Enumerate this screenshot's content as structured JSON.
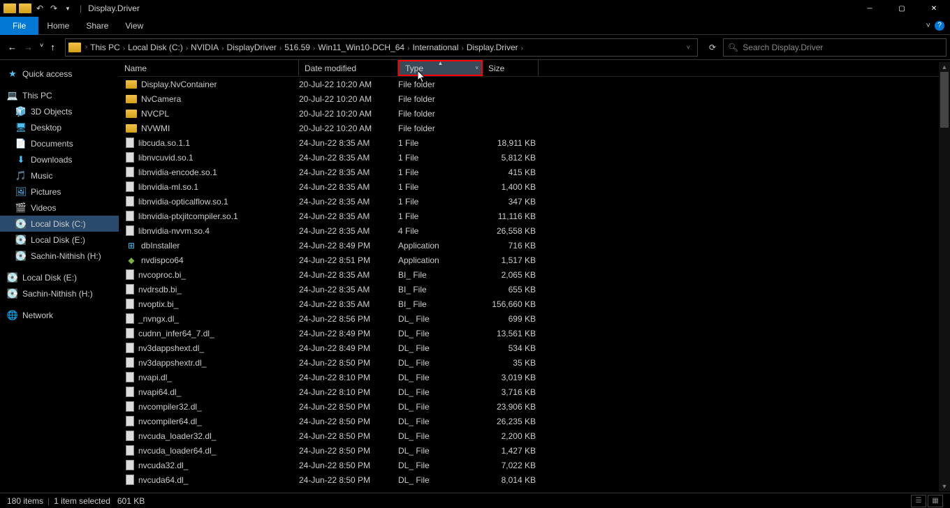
{
  "window": {
    "title": "Display.Driver"
  },
  "ribbon": {
    "file": "File",
    "home": "Home",
    "share": "Share",
    "view": "View"
  },
  "breadcrumb": [
    "This PC",
    "Local Disk (C:)",
    "NVIDIA",
    "DisplayDriver",
    "516.59",
    "Win11_Win10-DCH_64",
    "International",
    "Display.Driver"
  ],
  "search": {
    "placeholder": "Search Display.Driver"
  },
  "nav": {
    "quick": "Quick access",
    "thispc": "This PC",
    "thispc_items": [
      "3D Objects",
      "Desktop",
      "Documents",
      "Downloads",
      "Music",
      "Pictures",
      "Videos",
      "Local Disk (C:)",
      "Local Disk (E:)",
      "Sachin-Nithish (H:)"
    ],
    "drives": [
      "Local Disk (E:)",
      "Sachin-Nithish (H:)"
    ],
    "network": "Network"
  },
  "columns": {
    "name": "Name",
    "date": "Date modified",
    "type": "Type",
    "size": "Size"
  },
  "files": [
    {
      "name": "Display.NvContainer",
      "date": "20-Jul-22 10:20 AM",
      "type": "File folder",
      "size": "",
      "icon": "folder"
    },
    {
      "name": "NvCamera",
      "date": "20-Jul-22 10:20 AM",
      "type": "File folder",
      "size": "",
      "icon": "folder"
    },
    {
      "name": "NVCPL",
      "date": "20-Jul-22 10:20 AM",
      "type": "File folder",
      "size": "",
      "icon": "folder"
    },
    {
      "name": "NVWMI",
      "date": "20-Jul-22 10:20 AM",
      "type": "File folder",
      "size": "",
      "icon": "folder"
    },
    {
      "name": "libcuda.so.1.1",
      "date": "24-Jun-22 8:35 AM",
      "type": "1 File",
      "size": "18,911 KB",
      "icon": "doc"
    },
    {
      "name": "libnvcuvid.so.1",
      "date": "24-Jun-22 8:35 AM",
      "type": "1 File",
      "size": "5,812 KB",
      "icon": "doc"
    },
    {
      "name": "libnvidia-encode.so.1",
      "date": "24-Jun-22 8:35 AM",
      "type": "1 File",
      "size": "415 KB",
      "icon": "doc"
    },
    {
      "name": "libnvidia-ml.so.1",
      "date": "24-Jun-22 8:35 AM",
      "type": "1 File",
      "size": "1,400 KB",
      "icon": "doc"
    },
    {
      "name": "libnvidia-opticalflow.so.1",
      "date": "24-Jun-22 8:35 AM",
      "type": "1 File",
      "size": "347 KB",
      "icon": "doc"
    },
    {
      "name": "libnvidia-ptxjitcompiler.so.1",
      "date": "24-Jun-22 8:35 AM",
      "type": "1 File",
      "size": "11,116 KB",
      "icon": "doc"
    },
    {
      "name": "libnvidia-nvvm.so.4",
      "date": "24-Jun-22 8:35 AM",
      "type": "4 File",
      "size": "26,558 KB",
      "icon": "doc"
    },
    {
      "name": "dbInstaller",
      "date": "24-Jun-22 8:49 PM",
      "type": "Application",
      "size": "716 KB",
      "icon": "app"
    },
    {
      "name": "nvdispco64",
      "date": "24-Jun-22 8:51 PM",
      "type": "Application",
      "size": "1,517 KB",
      "icon": "app2"
    },
    {
      "name": "nvcoproc.bi_",
      "date": "24-Jun-22 8:35 AM",
      "type": "BI_ File",
      "size": "2,065 KB",
      "icon": "doc"
    },
    {
      "name": "nvdrsdb.bi_",
      "date": "24-Jun-22 8:35 AM",
      "type": "BI_ File",
      "size": "655 KB",
      "icon": "doc"
    },
    {
      "name": "nvoptix.bi_",
      "date": "24-Jun-22 8:35 AM",
      "type": "BI_ File",
      "size": "156,660 KB",
      "icon": "doc"
    },
    {
      "name": "_nvngx.dl_",
      "date": "24-Jun-22 8:56 PM",
      "type": "DL_ File",
      "size": "699 KB",
      "icon": "doc"
    },
    {
      "name": "cudnn_infer64_7.dl_",
      "date": "24-Jun-22 8:49 PM",
      "type": "DL_ File",
      "size": "13,561 KB",
      "icon": "doc"
    },
    {
      "name": "nv3dappshext.dl_",
      "date": "24-Jun-22 8:49 PM",
      "type": "DL_ File",
      "size": "534 KB",
      "icon": "doc"
    },
    {
      "name": "nv3dappshextr.dl_",
      "date": "24-Jun-22 8:50 PM",
      "type": "DL_ File",
      "size": "35 KB",
      "icon": "doc"
    },
    {
      "name": "nvapi.dl_",
      "date": "24-Jun-22 8:10 PM",
      "type": "DL_ File",
      "size": "3,019 KB",
      "icon": "doc"
    },
    {
      "name": "nvapi64.dl_",
      "date": "24-Jun-22 8:10 PM",
      "type": "DL_ File",
      "size": "3,716 KB",
      "icon": "doc"
    },
    {
      "name": "nvcompiler32.dl_",
      "date": "24-Jun-22 8:50 PM",
      "type": "DL_ File",
      "size": "23,906 KB",
      "icon": "doc"
    },
    {
      "name": "nvcompiler64.dl_",
      "date": "24-Jun-22 8:50 PM",
      "type": "DL_ File",
      "size": "26,235 KB",
      "icon": "doc"
    },
    {
      "name": "nvcuda_loader32.dl_",
      "date": "24-Jun-22 8:50 PM",
      "type": "DL_ File",
      "size": "2,200 KB",
      "icon": "doc"
    },
    {
      "name": "nvcuda_loader64.dl_",
      "date": "24-Jun-22 8:50 PM",
      "type": "DL_ File",
      "size": "1,427 KB",
      "icon": "doc"
    },
    {
      "name": "nvcuda32.dl_",
      "date": "24-Jun-22 8:50 PM",
      "type": "DL_ File",
      "size": "7,022 KB",
      "icon": "doc"
    },
    {
      "name": "nvcuda64.dl_",
      "date": "24-Jun-22 8:50 PM",
      "type": "DL_ File",
      "size": "8,014 KB",
      "icon": "doc"
    }
  ],
  "status": {
    "items": "180 items",
    "selected": "1 item selected",
    "size": "601 KB"
  },
  "nav_icons": {
    "3d": "🧊",
    "desktop": "🖥",
    "documents": "📄",
    "downloads": "⬇",
    "music": "🎵",
    "pictures": "🖼",
    "videos": "🎬",
    "disk": "💽",
    "network": "🌐",
    "pc": "💻",
    "star": "★"
  }
}
